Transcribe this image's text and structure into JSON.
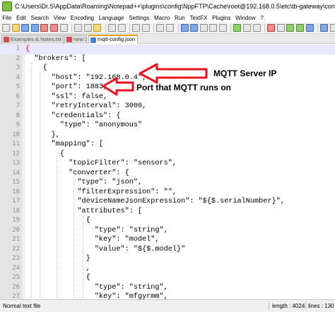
{
  "window": {
    "title": "C:\\Users\\Dr.S\\AppData\\Roaming\\Notepad++\\plugins\\config\\NppFTP\\Cache\\root@192.168.0.5\\etc\\tb-gateway\\conf\\mqtt-config.json - Notepad++"
  },
  "menu": [
    "File",
    "Edit",
    "Search",
    "View",
    "Encoding",
    "Language",
    "Settings",
    "Macro",
    "Run",
    "TextFX",
    "Plugins",
    "Window",
    "?"
  ],
  "tabs": [
    {
      "label": "Examples & Notes.txt",
      "active": false
    },
    {
      "label": "new 1",
      "active": false
    },
    {
      "label": "mqtt-config.json",
      "active": true
    }
  ],
  "editor": {
    "lines": [
      {
        "n": "1",
        "text": "{"
      },
      {
        "n": "2",
        "text": "  \"brokers\": ["
      },
      {
        "n": "3",
        "text": "    {"
      },
      {
        "n": "4",
        "text": "      \"host\": \"192.168.0.4\","
      },
      {
        "n": "5",
        "text": "      \"port\": 1883,"
      },
      {
        "n": "6",
        "text": "      \"ssl\": false,"
      },
      {
        "n": "7",
        "text": "      \"retryInterval\": 3000,"
      },
      {
        "n": "8",
        "text": "      \"credentials\": {"
      },
      {
        "n": "9",
        "text": "        \"type\": \"anonymous\""
      },
      {
        "n": "10",
        "text": "      },"
      },
      {
        "n": "11",
        "text": "      \"mapping\": ["
      },
      {
        "n": "12",
        "text": "        {"
      },
      {
        "n": "13",
        "text": "          \"topicFilter\": \"sensors\","
      },
      {
        "n": "14",
        "text": "          \"converter\": {"
      },
      {
        "n": "15",
        "text": "            \"type\": \"json\","
      },
      {
        "n": "16",
        "text": "            \"filterExpression\": \"\","
      },
      {
        "n": "17",
        "text": "            \"deviceNameJsonExpression\": \"${$.serialNumber}\","
      },
      {
        "n": "18",
        "text": "            \"attributes\": ["
      },
      {
        "n": "19",
        "text": "              {"
      },
      {
        "n": "20",
        "text": "                \"type\": \"string\","
      },
      {
        "n": "21",
        "text": "                \"key\": \"model\","
      },
      {
        "n": "22",
        "text": "                \"value\": \"${$.model}\""
      },
      {
        "n": "23",
        "text": "              }"
      },
      {
        "n": "24",
        "text": "              ,"
      },
      {
        "n": "25",
        "text": "              {"
      },
      {
        "n": "26",
        "text": "                \"type\": \"string\","
      },
      {
        "n": "27",
        "text": "                \"key\": \"mfgyrmm\","
      }
    ]
  },
  "annotations": {
    "host_label": "MQTT Server IP",
    "port_label": "Port that MQTT runs on",
    "arrow_color": "#e8141b"
  },
  "status": {
    "file_type": "Normal text file",
    "length": "length : 4024",
    "lines": "lines : 130"
  }
}
